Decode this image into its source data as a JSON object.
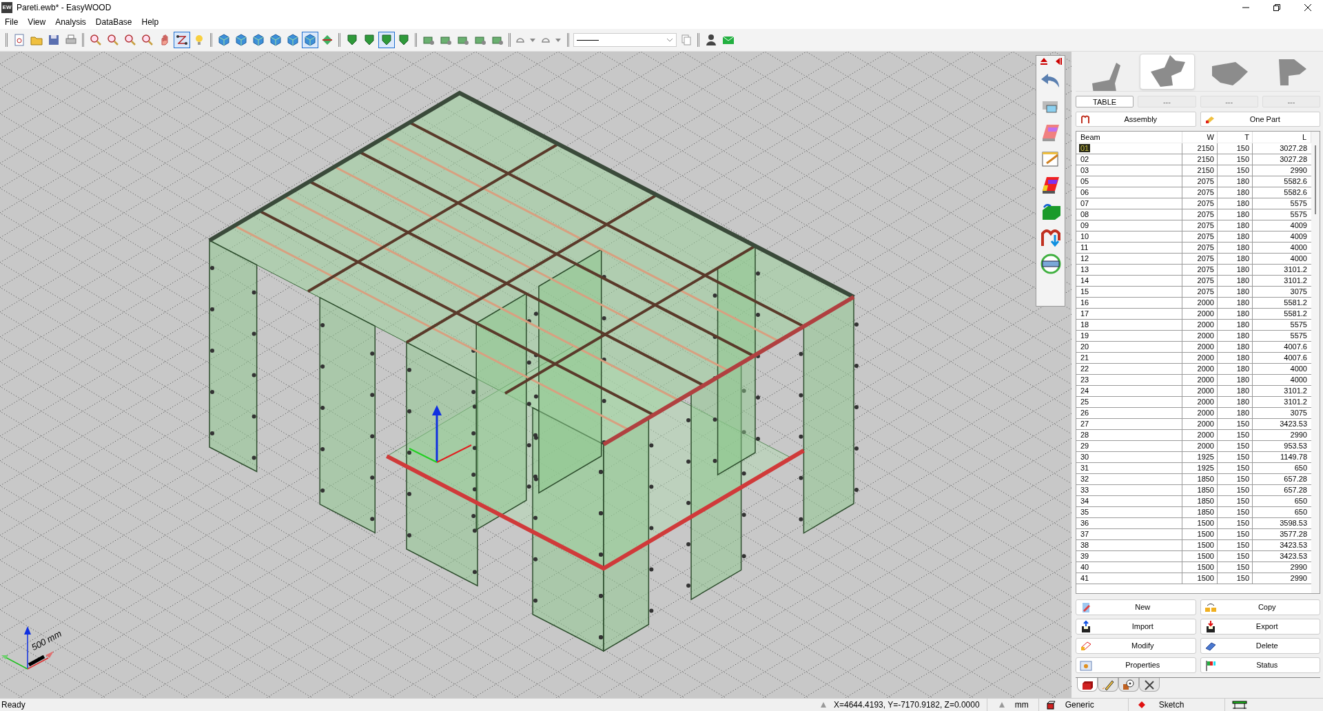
{
  "window": {
    "title": "Pareti.ewb* - EasyWOOD",
    "app_badge": "EW"
  },
  "menu": [
    "File",
    "View",
    "Analysis",
    "DataBase",
    "Help"
  ],
  "toolbar": [
    {
      "items": [
        {
          "kind": "doc",
          "selected": false
        },
        {
          "kind": "folder",
          "selected": false
        },
        {
          "kind": "save",
          "selected": false
        },
        {
          "kind": "print",
          "selected": false
        }
      ]
    },
    {
      "items": [
        {
          "kind": "zoom",
          "selected": false
        },
        {
          "kind": "zoom",
          "selected": false
        },
        {
          "kind": "zoom",
          "selected": false
        },
        {
          "kind": "zoom",
          "selected": false
        },
        {
          "kind": "hand",
          "selected": false
        },
        {
          "kind": "link",
          "selected": true
        },
        {
          "kind": "bulb",
          "selected": false
        }
      ]
    },
    {
      "items": [
        {
          "kind": "cube",
          "selected": false
        },
        {
          "kind": "cube",
          "selected": false
        },
        {
          "kind": "cube",
          "selected": false
        },
        {
          "kind": "cube",
          "selected": false
        },
        {
          "kind": "cube",
          "selected": false
        },
        {
          "kind": "cube",
          "selected": true
        },
        {
          "kind": "diamond",
          "selected": false
        }
      ]
    },
    {
      "items": [
        {
          "kind": "shield",
          "selected": false
        },
        {
          "kind": "shield",
          "selected": false
        },
        {
          "kind": "shield",
          "selected": true
        },
        {
          "kind": "shield",
          "selected": false
        }
      ]
    },
    {
      "items": [
        {
          "kind": "tool",
          "selected": false
        },
        {
          "kind": "tool",
          "selected": false
        },
        {
          "kind": "tool",
          "selected": false
        },
        {
          "kind": "tool",
          "selected": false
        },
        {
          "kind": "tool",
          "selected": false
        }
      ]
    },
    {
      "items": [
        {
          "kind": "dropdown",
          "selected": false
        },
        {
          "kind": "dropdown",
          "selected": false
        }
      ]
    },
    {
      "items": [
        {
          "kind": "combo",
          "selected": false
        },
        {
          "kind": "copy",
          "selected": false
        }
      ]
    },
    {
      "items": [
        {
          "kind": "user",
          "selected": false
        },
        {
          "kind": "mail",
          "selected": false
        }
      ]
    }
  ],
  "viewport": {
    "scale_label": "500 mm"
  },
  "panel": {
    "views": [
      {
        "selected": false
      },
      {
        "selected": true
      },
      {
        "selected": false
      },
      {
        "selected": false
      }
    ],
    "tabs": [
      {
        "label": "TABLE",
        "selected": true
      },
      {
        "label": "---",
        "selected": false
      },
      {
        "label": "---",
        "selected": false
      },
      {
        "label": "---",
        "selected": false
      }
    ],
    "modes": [
      "Assembly",
      "One Part"
    ],
    "table": {
      "columns": [
        "Beam",
        "W",
        "T",
        "L"
      ],
      "rows": [
        {
          "cells": [
            "01",
            "2150",
            "150",
            "3027.28"
          ],
          "selected": true
        },
        {
          "cells": [
            "02",
            "2150",
            "150",
            "3027.28"
          ],
          "selected": false
        },
        {
          "cells": [
            "03",
            "2150",
            "150",
            "2990"
          ],
          "selected": false
        },
        {
          "cells": [
            "05",
            "2075",
            "180",
            "5582.6"
          ],
          "selected": false
        },
        {
          "cells": [
            "06",
            "2075",
            "180",
            "5582.6"
          ],
          "selected": false
        },
        {
          "cells": [
            "07",
            "2075",
            "180",
            "5575"
          ],
          "selected": false
        },
        {
          "cells": [
            "08",
            "2075",
            "180",
            "5575"
          ],
          "selected": false
        },
        {
          "cells": [
            "09",
            "2075",
            "180",
            "4009"
          ],
          "selected": false
        },
        {
          "cells": [
            "10",
            "2075",
            "180",
            "4009"
          ],
          "selected": false
        },
        {
          "cells": [
            "11",
            "2075",
            "180",
            "4000"
          ],
          "selected": false
        },
        {
          "cells": [
            "12",
            "2075",
            "180",
            "4000"
          ],
          "selected": false
        },
        {
          "cells": [
            "13",
            "2075",
            "180",
            "3101.2"
          ],
          "selected": false
        },
        {
          "cells": [
            "14",
            "2075",
            "180",
            "3101.2"
          ],
          "selected": false
        },
        {
          "cells": [
            "15",
            "2075",
            "180",
            "3075"
          ],
          "selected": false
        },
        {
          "cells": [
            "16",
            "2000",
            "180",
            "5581.2"
          ],
          "selected": false
        },
        {
          "cells": [
            "17",
            "2000",
            "180",
            "5581.2"
          ],
          "selected": false
        },
        {
          "cells": [
            "18",
            "2000",
            "180",
            "5575"
          ],
          "selected": false
        },
        {
          "cells": [
            "19",
            "2000",
            "180",
            "5575"
          ],
          "selected": false
        },
        {
          "cells": [
            "20",
            "2000",
            "180",
            "4007.6"
          ],
          "selected": false
        },
        {
          "cells": [
            "21",
            "2000",
            "180",
            "4007.6"
          ],
          "selected": false
        },
        {
          "cells": [
            "22",
            "2000",
            "180",
            "4000"
          ],
          "selected": false
        },
        {
          "cells": [
            "23",
            "2000",
            "180",
            "4000"
          ],
          "selected": false
        },
        {
          "cells": [
            "24",
            "2000",
            "180",
            "3101.2"
          ],
          "selected": false
        },
        {
          "cells": [
            "25",
            "2000",
            "180",
            "3101.2"
          ],
          "selected": false
        },
        {
          "cells": [
            "26",
            "2000",
            "180",
            "3075"
          ],
          "selected": false
        },
        {
          "cells": [
            "27",
            "2000",
            "150",
            "3423.53"
          ],
          "selected": false
        },
        {
          "cells": [
            "28",
            "2000",
            "150",
            "2990"
          ],
          "selected": false
        },
        {
          "cells": [
            "29",
            "2000",
            "150",
            "953.53"
          ],
          "selected": false
        },
        {
          "cells": [
            "30",
            "1925",
            "150",
            "1149.78"
          ],
          "selected": false
        },
        {
          "cells": [
            "31",
            "1925",
            "150",
            "650"
          ],
          "selected": false
        },
        {
          "cells": [
            "32",
            "1850",
            "150",
            "657.28"
          ],
          "selected": false
        },
        {
          "cells": [
            "33",
            "1850",
            "150",
            "657.28"
          ],
          "selected": false
        },
        {
          "cells": [
            "34",
            "1850",
            "150",
            "650"
          ],
          "selected": false
        },
        {
          "cells": [
            "35",
            "1850",
            "150",
            "650"
          ],
          "selected": false
        },
        {
          "cells": [
            "36",
            "1500",
            "150",
            "3598.53"
          ],
          "selected": false
        },
        {
          "cells": [
            "37",
            "1500",
            "150",
            "3577.28"
          ],
          "selected": false
        },
        {
          "cells": [
            "38",
            "1500",
            "150",
            "3423.53"
          ],
          "selected": false
        },
        {
          "cells": [
            "39",
            "1500",
            "150",
            "3423.53"
          ],
          "selected": false
        },
        {
          "cells": [
            "40",
            "1500",
            "150",
            "2990"
          ],
          "selected": false
        },
        {
          "cells": [
            "41",
            "1500",
            "150",
            "2990"
          ],
          "selected": false
        }
      ]
    },
    "actions": [
      {
        "label": "New",
        "kind": "new"
      },
      {
        "label": "Copy",
        "kind": "copy"
      },
      {
        "label": "Import",
        "kind": "import"
      },
      {
        "label": "Export",
        "kind": "export"
      },
      {
        "label": "Modify",
        "kind": "modify"
      },
      {
        "label": "Delete",
        "kind": "delete"
      },
      {
        "label": "Properties",
        "kind": "properties"
      },
      {
        "label": "Status",
        "kind": "status"
      }
    ],
    "bottom_tabs": [
      {
        "kind": "part",
        "selected": true
      },
      {
        "kind": "pencil",
        "selected": false
      },
      {
        "kind": "target",
        "selected": false
      },
      {
        "kind": "tools",
        "selected": false
      }
    ]
  },
  "status_bar": {
    "message": "Ready",
    "coordinates": "X=4644.4193, Y=-7170.9182, Z=0.0000",
    "units": "mm",
    "material": "Generic",
    "mode": "Sketch"
  }
}
